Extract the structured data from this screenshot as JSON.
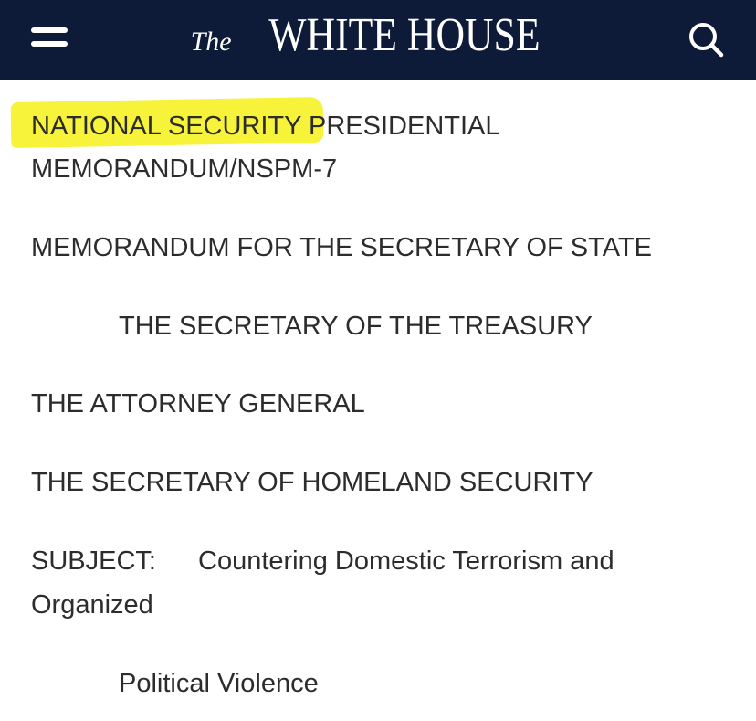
{
  "header": {
    "brand_prefix": "The",
    "brand_name": "WHITE HOUSE",
    "background": "#0d1a38",
    "menu_icon": "hamburger-menu-icon",
    "search_icon": "search-icon"
  },
  "document": {
    "title_highlighted": "NATIONAL SECURITY",
    "title_rest": " PRESIDENTIAL",
    "title_line2": "MEMORANDUM/NSPM-7",
    "memo_for": "MEMORANDUM FOR THE SECRETARY OF STATE",
    "recipient_1": "THE SECRETARY OF THE TREASURY",
    "recipient_2": "THE ATTORNEY GENERAL",
    "recipient_3": "THE SECRETARY OF HOMELAND SECURITY",
    "subject_label": "SUBJECT:",
    "subject_text_1": "Countering Domestic Terrorism and",
    "subject_text_2": "Organized",
    "subject_text_3": "Political Violence",
    "highlight_color": "#f7f23a"
  }
}
